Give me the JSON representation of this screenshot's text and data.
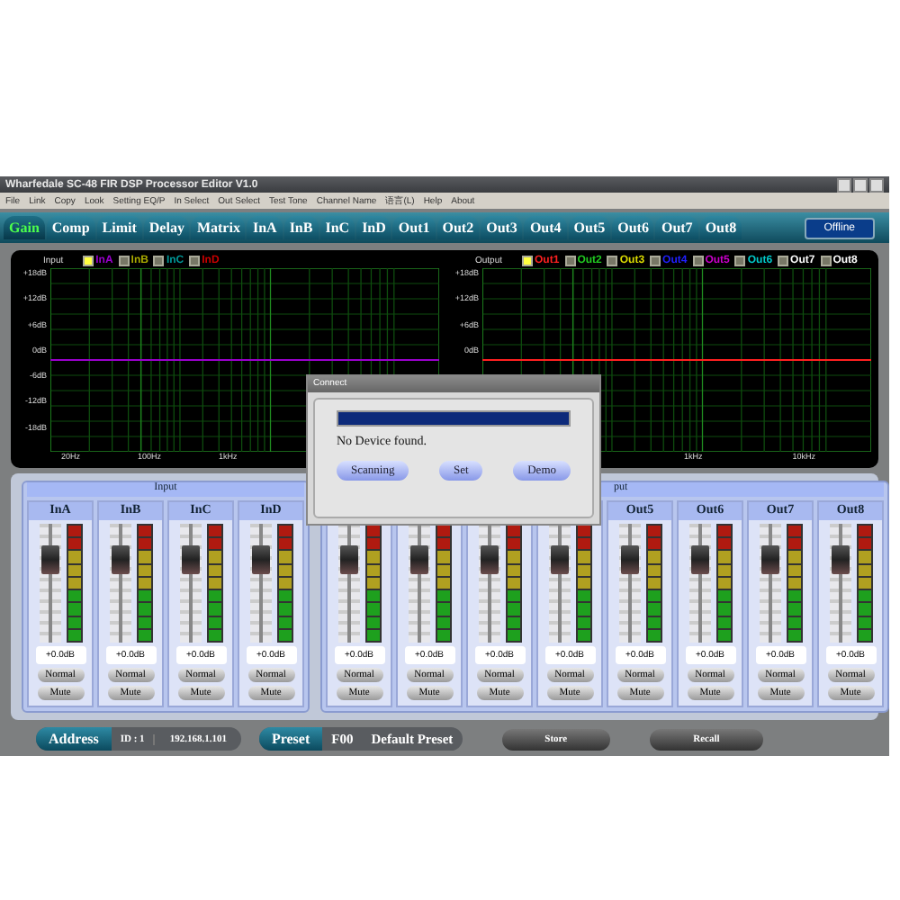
{
  "window": {
    "title": "Wharfedale SC-48 FIR DSP Processor Editor V1.0"
  },
  "menu": [
    "File",
    "Link",
    "Copy",
    "Look",
    "Setting EQ/P",
    "In Select",
    "Out Select",
    "Test Tone",
    "Channel Name",
    "语言(L)",
    "Help",
    "About"
  ],
  "tabs": [
    {
      "label": "Gain",
      "selected": true
    },
    {
      "label": "Comp",
      "selected": false
    },
    {
      "label": "Limit",
      "selected": false
    },
    {
      "label": "Delay",
      "selected": false
    },
    {
      "label": "Matrix",
      "selected": false
    },
    {
      "label": "InA",
      "selected": false
    },
    {
      "label": "InB",
      "selected": false
    },
    {
      "label": "InC",
      "selected": false
    },
    {
      "label": "InD",
      "selected": false
    },
    {
      "label": "Out1",
      "selected": false
    },
    {
      "label": "Out2",
      "selected": false
    },
    {
      "label": "Out3",
      "selected": false
    },
    {
      "label": "Out4",
      "selected": false
    },
    {
      "label": "Out5",
      "selected": false
    },
    {
      "label": "Out6",
      "selected": false
    },
    {
      "label": "Out7",
      "selected": false
    },
    {
      "label": "Out8",
      "selected": false
    }
  ],
  "status_button": "Offline",
  "graphs": [
    {
      "title": "Input",
      "legend": [
        {
          "label": "InA",
          "color": "#9900cc",
          "checked": true
        },
        {
          "label": "InB",
          "color": "#aaaa00",
          "checked": false
        },
        {
          "label": "InC",
          "color": "#009999",
          "checked": false
        },
        {
          "label": "InD",
          "color": "#cc0000",
          "checked": false
        }
      ],
      "yticks": [
        "+18dB",
        "+12dB",
        "+6dB",
        "0dB",
        "-6dB",
        "-12dB",
        "-18dB"
      ],
      "xticks": [
        "20Hz",
        "100Hz",
        "1kHz"
      ]
    },
    {
      "title": "Output",
      "legend": [
        {
          "label": "Out1",
          "color": "#ff2020",
          "checked": true
        },
        {
          "label": "Out2",
          "color": "#20cc20",
          "checked": false
        },
        {
          "label": "Out3",
          "color": "#dddd00",
          "checked": false
        },
        {
          "label": "Out4",
          "color": "#2020ff",
          "checked": false
        },
        {
          "label": "Out5",
          "color": "#cc00cc",
          "checked": false
        },
        {
          "label": "Out6",
          "color": "#00cccc",
          "checked": false
        },
        {
          "label": "Out7",
          "color": "#ffffff",
          "checked": false
        },
        {
          "label": "Out8",
          "color": "#ffffff",
          "checked": false
        }
      ],
      "yticks": [
        "+18dB",
        "+12dB",
        "+6dB",
        "0dB"
      ],
      "xticks": [
        "1kHz",
        "10kHz"
      ]
    }
  ],
  "panels": [
    {
      "title": "Input",
      "channels": [
        {
          "label": "InA",
          "level": 0.7,
          "reading": "+0.0dB",
          "mode": "Normal",
          "mute": "Mute"
        },
        {
          "label": "InB",
          "level": 0.7,
          "reading": "+0.0dB",
          "mode": "Normal",
          "mute": "Mute"
        },
        {
          "label": "InC",
          "level": 0.7,
          "reading": "+0.0dB",
          "mode": "Normal",
          "mute": "Mute"
        },
        {
          "label": "InD",
          "level": 0.7,
          "reading": "+0.0dB",
          "mode": "Normal",
          "mute": "Mute"
        }
      ]
    },
    {
      "title": "put",
      "channels": [
        {
          "level": 0.7,
          "reading": "+0.0dB",
          "mode": "Normal",
          "mute": "Mute"
        },
        {
          "level": 0.7,
          "reading": "+0.0dB",
          "mode": "Normal",
          "mute": "Mute"
        },
        {
          "level": 0.7,
          "reading": "+0.0dB",
          "mode": "Normal",
          "mute": "Mute"
        },
        {
          "level": 0.7,
          "reading": "+0.0dB",
          "mode": "Normal",
          "mute": "Mute"
        },
        {
          "label": "Out5",
          "level": 0.7,
          "reading": "+0.0dB",
          "mode": "Normal",
          "mute": "Mute"
        },
        {
          "label": "Out6",
          "level": 0.7,
          "reading": "+0.0dB",
          "mode": "Normal",
          "mute": "Mute"
        },
        {
          "label": "Out7",
          "level": 0.7,
          "reading": "+0.0dB",
          "mode": "Normal",
          "mute": "Mute"
        },
        {
          "label": "Out8",
          "level": 0.7,
          "reading": "+0.0dB",
          "mode": "Normal",
          "mute": "Mute"
        }
      ]
    }
  ],
  "bottom_bar": {
    "address_label": "Address",
    "id": "ID : 1",
    "ip": "192.168.1.101",
    "preset_label": "Preset",
    "preset_number": "F00",
    "preset_name": "Default Preset",
    "buttons": [
      "Store",
      "Recall"
    ]
  },
  "dialog": {
    "title": "Connect",
    "progress": {
      "level": 1
    },
    "message": "No Device found.",
    "buttons": [
      "Scanning",
      "Set",
      "Demo"
    ]
  }
}
